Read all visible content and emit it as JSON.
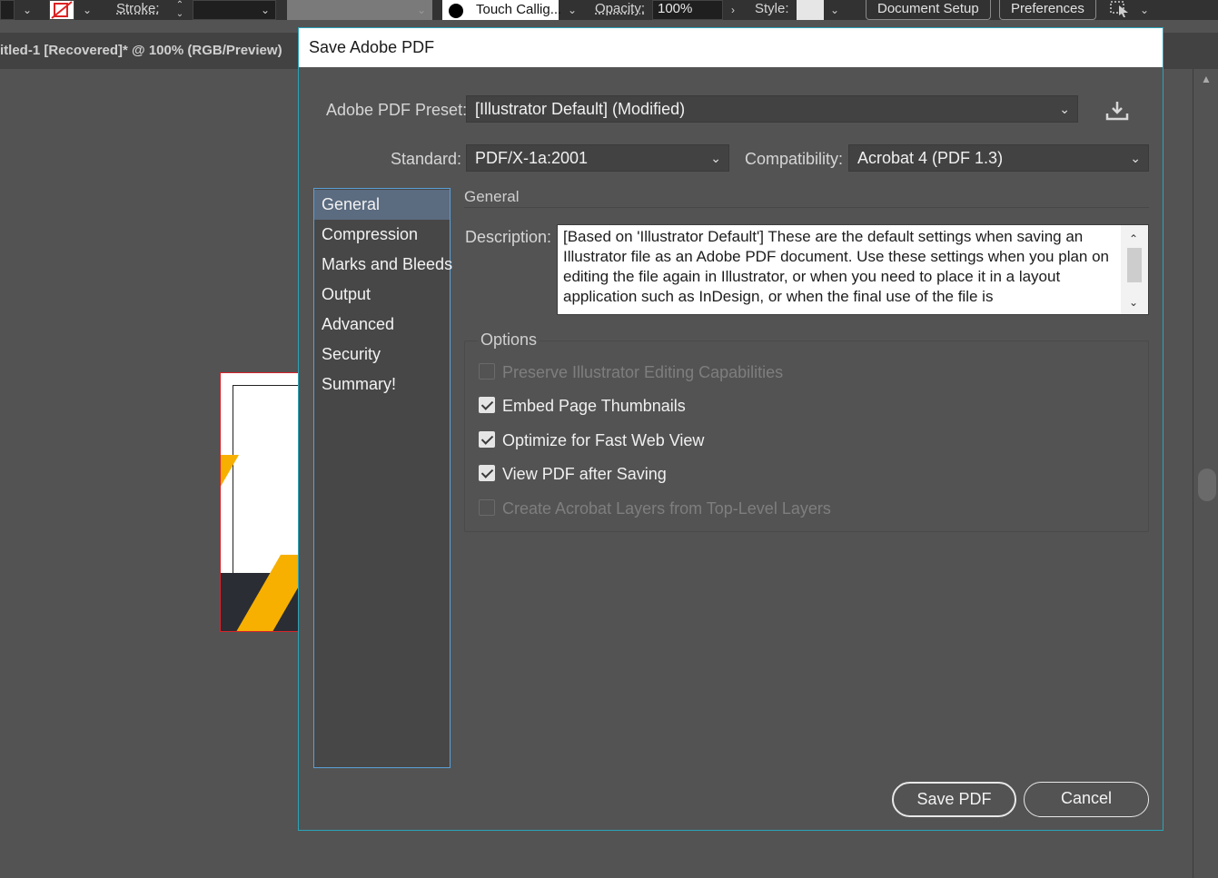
{
  "toolbar": {
    "stroke_label": "Stroke:",
    "brush_name": "Touch Callig...",
    "opacity_label": "Opacity:",
    "opacity_value": "100%",
    "style_label": "Style:",
    "document_setup": "Document Setup",
    "preferences": "Preferences"
  },
  "document_tab": {
    "title": "itled-1 [Recovered]* @ 100% (RGB/Preview)"
  },
  "dialog": {
    "title": "Save Adobe PDF",
    "preset_label": "Adobe PDF Preset:",
    "preset_value": "[Illustrator Default] (Modified)",
    "standard_label": "Standard:",
    "standard_value": "PDF/X-1a:2001",
    "compatibility_label": "Compatibility:",
    "compatibility_value": "Acrobat 4 (PDF 1.3)",
    "sidebar": [
      {
        "label": "General",
        "selected": true
      },
      {
        "label": "Compression",
        "selected": false
      },
      {
        "label": "Marks and Bleeds",
        "selected": false
      },
      {
        "label": "Output",
        "selected": false
      },
      {
        "label": "Advanced",
        "selected": false
      },
      {
        "label": "Security",
        "selected": false
      },
      {
        "label": "Summary!",
        "selected": false
      }
    ],
    "section_title": "General",
    "description_label": "Description:",
    "description_text": "[Based on 'Illustrator Default'] These are the default settings when saving an Illustrator file as an Adobe PDF document. Use these settings when you plan on editing the file again in Illustrator, or when you need to place it in a layout application such as InDesign, or when the final use of the file is",
    "options_title": "Options",
    "options": [
      {
        "label": "Preserve Illustrator Editing Capabilities",
        "checked": false,
        "enabled": false
      },
      {
        "label": "Embed Page Thumbnails",
        "checked": true,
        "enabled": true
      },
      {
        "label": "Optimize for Fast Web View",
        "checked": true,
        "enabled": true
      },
      {
        "label": "View PDF after Saving",
        "checked": true,
        "enabled": true
      },
      {
        "label": "Create Acrobat Layers from Top-Level Layers",
        "checked": false,
        "enabled": false
      }
    ],
    "save_button": "Save PDF",
    "cancel_button": "Cancel"
  },
  "colors": {
    "dialog_bg": "#535353",
    "accent_border": "#2aa3b8",
    "selection": "#5b6b80"
  }
}
